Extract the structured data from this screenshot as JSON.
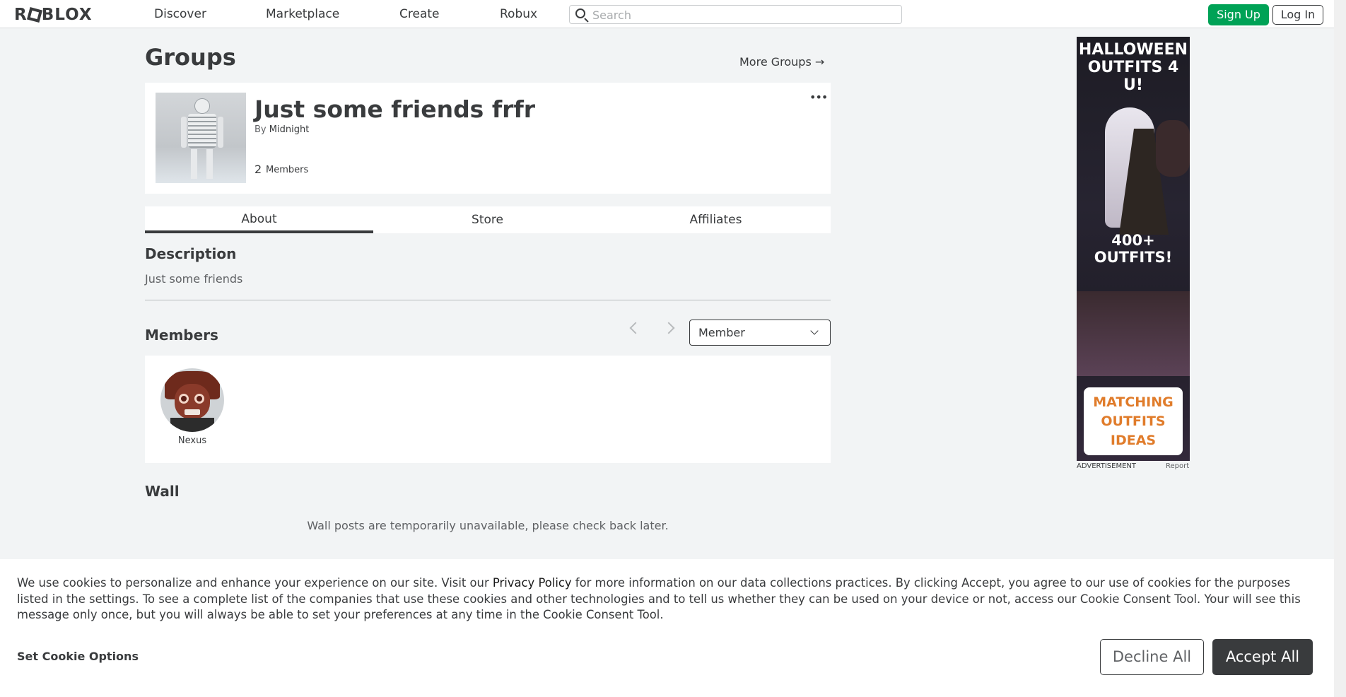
{
  "nav": {
    "logo": "ROBLOX",
    "links": [
      "Discover",
      "Marketplace",
      "Create",
      "Robux"
    ],
    "search_placeholder": "Search",
    "signup": "Sign Up",
    "login": "Log In"
  },
  "page": {
    "title": "Groups",
    "more_groups": "More Groups →"
  },
  "group": {
    "name": "Just some friends frfr",
    "by_label": "By",
    "owner": "Midnight",
    "member_count": "2",
    "members_label": "Members",
    "more_icon": "•••"
  },
  "tabs": [
    "About",
    "Store",
    "Affiliates"
  ],
  "active_tab": "About",
  "about": {
    "description_title": "Description",
    "description": "Just some friends"
  },
  "members": {
    "title": "Members",
    "role_filter": "Member",
    "list": [
      {
        "name": "Nexus"
      }
    ]
  },
  "wall": {
    "title": "Wall",
    "message": "Wall posts are temporarily unavailable, please check back later."
  },
  "ad": {
    "headline": "HALLOWEEN OUTFITS 4 U!",
    "middle": "400+ OUTFITS!",
    "brand": "MATCHING OUTFITS IDEAS",
    "label": "ADVERTISEMENT",
    "report": "Report"
  },
  "cookie": {
    "text_before_link": "We use cookies to personalize and enhance your experience on our site. Visit our ",
    "link": "Privacy Policy",
    "text_after_link": " for more information on our data collections practices. By clicking Accept, you agree to our use of cookies for the purposes listed in the settings. To see a complete list of the companies that use these cookies and other technologies and to tell us whether they can be used on your device or not, access our Cookie Consent Tool. Your will see this message only once, but you will always be able to set your preferences at any time in the Cookie Consent Tool.",
    "options": "Set Cookie Options",
    "decline": "Decline All",
    "accept": "Accept All"
  },
  "colors": {
    "signup_green": "#00a256",
    "text_dark": "#393b3d",
    "background": "#f2f4f5"
  }
}
